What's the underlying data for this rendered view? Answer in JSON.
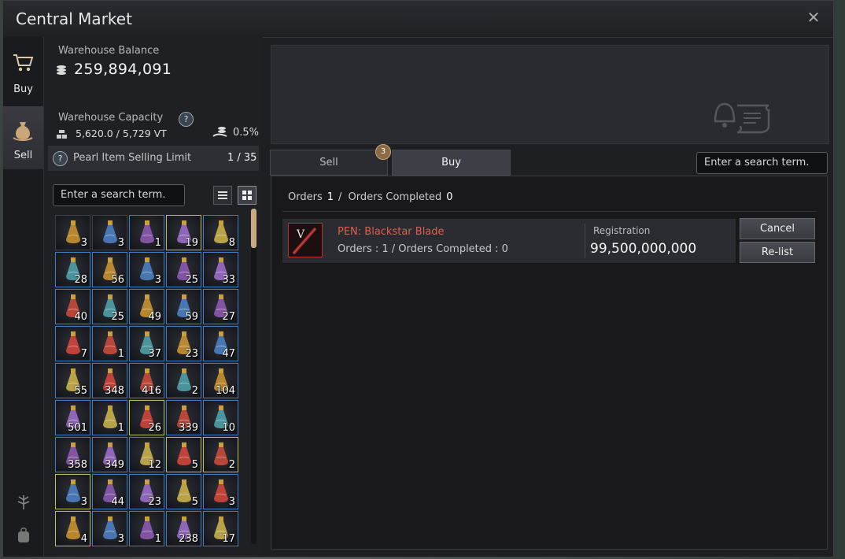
{
  "window": {
    "title": "Central Market"
  },
  "nav": [
    {
      "label": "Buy",
      "icon": "cart-icon",
      "active": false
    },
    {
      "label": "Sell",
      "icon": "money-bag-icon",
      "active": true
    }
  ],
  "warehouse": {
    "balance_label": "Warehouse Balance",
    "balance": "259,894,091",
    "capacity_label": "Warehouse Capacity",
    "capacity": "5,620.0 / 5,729 VT",
    "tax": "0.5%",
    "pearl_label": "Pearl Item Selling Limit",
    "pearl_value": "1 / 35"
  },
  "left_search": {
    "placeholder": "Enter a search term."
  },
  "inventory": [
    [
      "3",
      "3",
      "1",
      "19",
      "8"
    ],
    [
      "28",
      "56",
      "3",
      "25",
      "33"
    ],
    [
      "40",
      "25",
      "49",
      "59",
      "27"
    ],
    [
      "7",
      "1",
      "37",
      "23",
      "47"
    ],
    [
      "55",
      "348",
      "416",
      "2",
      "104"
    ],
    [
      "501",
      "1",
      "26",
      "339",
      "10"
    ],
    [
      "358",
      "349",
      "12",
      "5",
      "2"
    ],
    [
      "3",
      "44",
      "23",
      "5",
      "3"
    ],
    [
      "4",
      "3",
      "1",
      "238",
      "17"
    ]
  ],
  "tabs": {
    "sell": "Sell",
    "buy": "Buy",
    "badge": "3"
  },
  "right_search": {
    "placeholder": "Enter a search term."
  },
  "orders": {
    "orders_label": "Orders",
    "orders_count": "1",
    "sep": "/",
    "completed_label": "Orders Completed",
    "completed_count": "0"
  },
  "order_row": {
    "name": "PEN: Blackstar Blade",
    "sub": "Orders : 1 / Orders Completed : 0",
    "reg_label": "Registration",
    "reg_value": "99,500,000,000",
    "cancel": "Cancel",
    "relist": "Re-list"
  },
  "colors": {
    "accent_item": "#e35d4f",
    "slot_blue": "#3f7dc4",
    "slot_yellow": "#b9c35a",
    "scroll_thumb": "#c9a983"
  }
}
